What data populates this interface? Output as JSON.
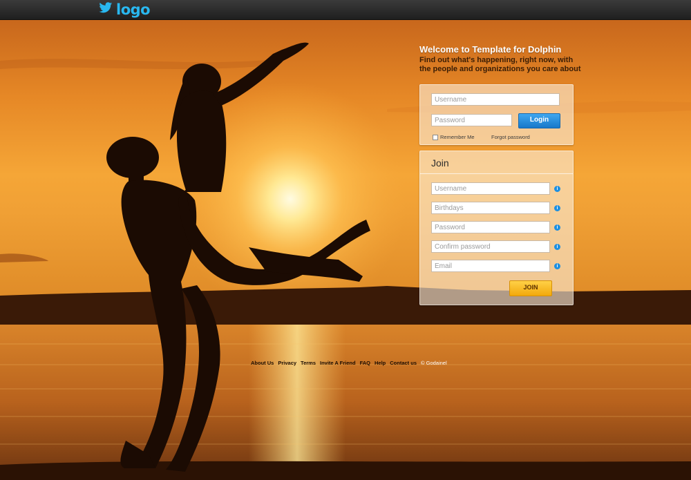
{
  "header": {
    "logo_text": "logo",
    "logo_icon": "twitter-bird-icon",
    "brand_color": "#29b8f0"
  },
  "welcome": {
    "title": "Welcome to Template for Dolphin",
    "subtitle": "Find out what's happening, right now, with the people and organizations you care about"
  },
  "login": {
    "username_placeholder": "Username",
    "password_placeholder": "Password",
    "login_label": "Login",
    "remember_label": "Remember Me",
    "remember_checked": false,
    "forgot_label": "Forgot password"
  },
  "join": {
    "title": "Join",
    "fields": [
      {
        "placeholder": "Username"
      },
      {
        "placeholder": "Birthdays"
      },
      {
        "placeholder": "Password"
      },
      {
        "placeholder": "Confirm password"
      },
      {
        "placeholder": "Email"
      }
    ],
    "info_icon": "info-icon",
    "join_label": "JOIN"
  },
  "footer": {
    "links": [
      "About Us",
      "Privacy",
      "Terms",
      "Invite A Friend",
      "FAQ",
      "Help",
      "Contact us"
    ],
    "copyright": "© Godainel"
  },
  "colors": {
    "login_button": "#1f86d6",
    "join_button": "#f5b21c",
    "sky": "#f19a2e"
  }
}
